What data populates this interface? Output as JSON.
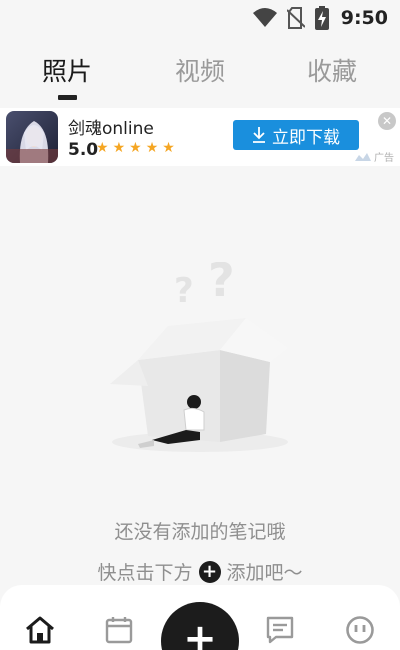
{
  "status_bar": {
    "time": "9:50",
    "icons": [
      "wifi-icon",
      "no-sim-icon",
      "battery-charging-icon"
    ]
  },
  "tabs": [
    {
      "label": "照片",
      "active": true
    },
    {
      "label": "视频",
      "active": false
    },
    {
      "label": "收藏",
      "active": false
    }
  ],
  "ad": {
    "title": "剑魂online",
    "rating": "5.0",
    "stars": 5,
    "download_label": "立即下载",
    "tag_label": "广告",
    "accent": "#1a8fdd",
    "star_color": "#f5a623"
  },
  "empty_state": {
    "line1": "还没有添加的笔记哦",
    "line2_before": "快点击下方",
    "line2_after": "添加吧～"
  },
  "bottom_nav": {
    "items": [
      "home-icon",
      "calendar-icon",
      "add-icon",
      "notes-icon",
      "profile-icon"
    ],
    "active": "home-icon"
  }
}
